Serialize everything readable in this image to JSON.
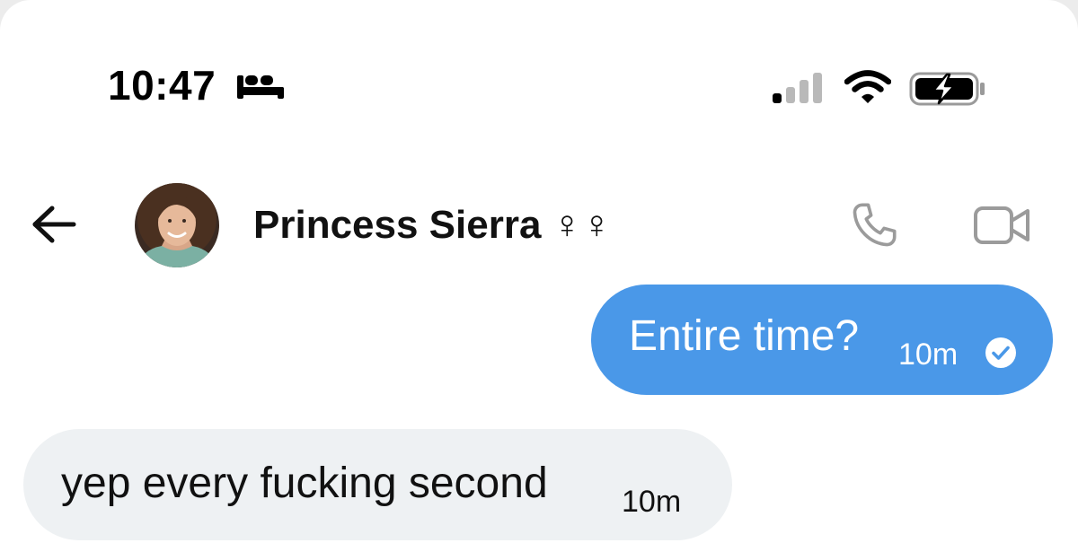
{
  "status_bar": {
    "time": "10:47",
    "focus_mode_icon": "bed-icon",
    "signal_icon": "cellular-signal-icon",
    "wifi_icon": "wifi-icon",
    "battery_icon": "battery-charging-icon"
  },
  "header": {
    "back_icon": "arrow-left-icon",
    "contact_name": "Princess Sierra ♀♀",
    "call_icon": "phone-icon",
    "video_icon": "video-camera-icon"
  },
  "messages": [
    {
      "direction": "outgoing",
      "text": "Entire time?",
      "time": "10m",
      "status_icon": "read-check-icon"
    },
    {
      "direction": "incoming",
      "text": "yep every fucking second",
      "time": "10m"
    }
  ],
  "colors": {
    "outgoing_bubble": "#4a98e8",
    "incoming_bubble": "#eef1f3",
    "header_icon_gray": "#9b9b9b"
  }
}
